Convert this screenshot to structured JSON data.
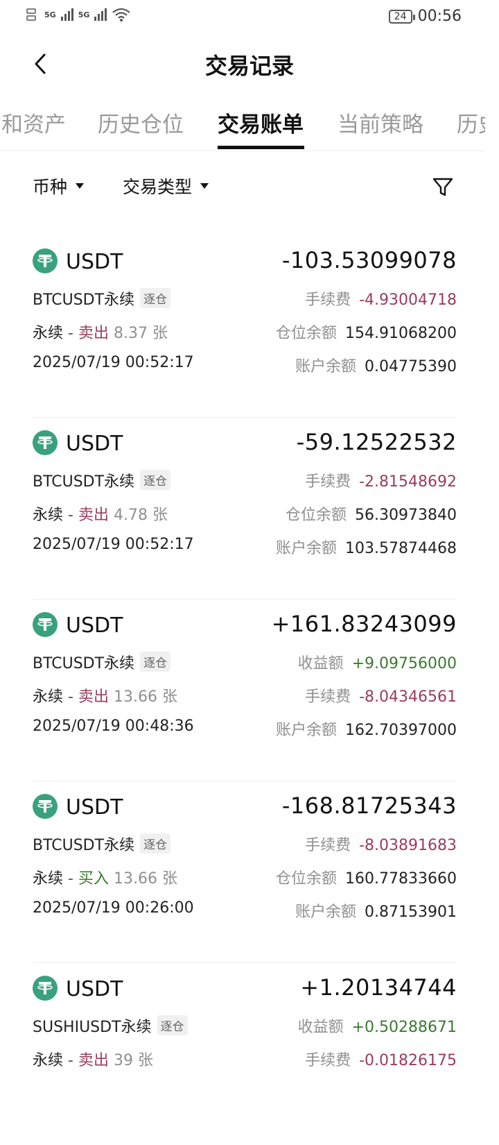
{
  "status": {
    "battery": "24",
    "time": "00:56",
    "net1": "5G",
    "net2": "5G"
  },
  "header": {
    "title": "交易记录"
  },
  "tabs": [
    {
      "label": "和资产"
    },
    {
      "label": "历史仓位"
    },
    {
      "label": "交易账单"
    },
    {
      "label": "当前策略"
    },
    {
      "label": "历史"
    }
  ],
  "filters": {
    "coin": "币种",
    "type": "交易类型"
  },
  "records": [
    {
      "coin": "USDT",
      "amount": "-103.53099078",
      "pair": "BTCUSDT永续",
      "tag": "逐仓",
      "kind": "永续",
      "side": "卖出",
      "qty": "8.37 张",
      "time": "2025/07/19 00:52:17",
      "k1": "手续费",
      "v1": "-4.93004718",
      "k2": "仓位余额",
      "v2": "154.91068200",
      "k3": "账户余额",
      "v3": "0.04775390"
    },
    {
      "coin": "USDT",
      "amount": "-59.12522532",
      "pair": "BTCUSDT永续",
      "tag": "逐仓",
      "kind": "永续",
      "side": "卖出",
      "qty": "4.78 张",
      "time": "2025/07/19 00:52:17",
      "k1": "手续费",
      "v1": "-2.81548692",
      "k2": "仓位余额",
      "v2": "56.30973840",
      "k3": "账户余额",
      "v3": "103.57874468"
    },
    {
      "coin": "USDT",
      "amount": "+161.83243099",
      "pair": "BTCUSDT永续",
      "tag": "逐仓",
      "kind": "永续",
      "side": "卖出",
      "qty": "13.66 张",
      "time": "2025/07/19 00:48:36",
      "k1": "收益额",
      "v1": "+9.09756000",
      "k2": "手续费",
      "v2": "-8.04346561",
      "k3": "账户余额",
      "v3": "162.70397000"
    },
    {
      "coin": "USDT",
      "amount": "-168.81725343",
      "pair": "BTCUSDT永续",
      "tag": "逐仓",
      "kind": "永续",
      "side": "买入",
      "qty": "13.66 张",
      "time": "2025/07/19 00:26:00",
      "k1": "手续费",
      "v1": "-8.03891683",
      "k2": "仓位余额",
      "v2": "160.77833660",
      "k3": "账户余额",
      "v3": "0.87153901"
    },
    {
      "coin": "USDT",
      "amount": "+1.20134744",
      "pair": "SUSHIUSDT永续",
      "tag": "逐仓",
      "kind": "永续",
      "side": "卖出",
      "qty": "39 张",
      "time": "",
      "k1": "收益额",
      "v1": "+0.50288671",
      "k2": "手续费",
      "v2": "-0.01826175",
      "k3": "",
      "v3": ""
    }
  ],
  "colors": {
    "accent": "#111111",
    "negative": "#9a3c5c",
    "positive": "#3a7a2e",
    "tether": "#3aa17e"
  }
}
